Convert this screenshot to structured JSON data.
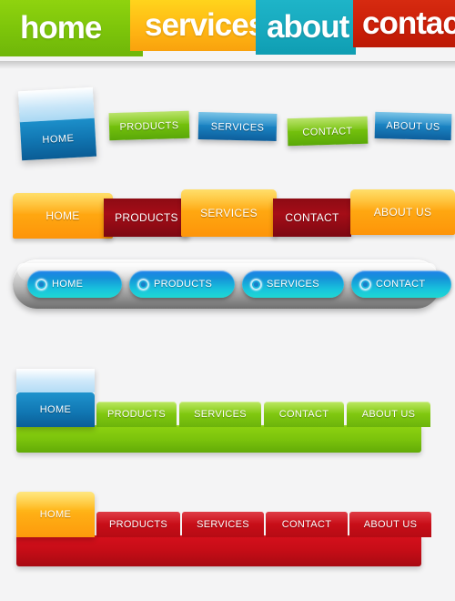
{
  "banner": {
    "blocks": [
      {
        "label": "home",
        "color": "#7cc40a"
      },
      {
        "label": "services",
        "color": "#ffb513"
      },
      {
        "label": "about",
        "color": "#16a8bd"
      },
      {
        "label": "contact",
        "color": "#cb1f08"
      }
    ]
  },
  "glossy_buttons": {
    "home_label": "HOME",
    "items": [
      {
        "label": "PRODUCTS",
        "color": "#73c00c"
      },
      {
        "label": "SERVICES",
        "color": "#1b85c4"
      },
      {
        "label": "CONTACT",
        "color": "#73c00c"
      },
      {
        "label": "ABOUT US",
        "color": "#1b85c4"
      }
    ]
  },
  "orange_red_bar": {
    "items": [
      {
        "label": "HOME",
        "color": "#ffa811"
      },
      {
        "label": "PRODUCTS",
        "color": "#a50d17"
      },
      {
        "label": "SERVICES",
        "color": "#ffa811"
      },
      {
        "label": "CONTACT",
        "color": "#a50d17"
      },
      {
        "label": "ABOUT US",
        "color": "#ffa811"
      }
    ]
  },
  "silver_bar": {
    "items": [
      {
        "label": "HOME",
        "icon": "globe-icon"
      },
      {
        "label": "PRODUCTS",
        "icon": "globe-icon"
      },
      {
        "label": "SERVICES",
        "icon": "globe-icon"
      },
      {
        "label": "CONTACT",
        "icon": "globe-icon"
      }
    ],
    "pill_color": "#18c4dd",
    "bar_color": "#b9b9b9"
  },
  "green_bar": {
    "home_label": "HOME",
    "home_color": "#1178b4",
    "bar_color": "#7cc40c",
    "items": [
      {
        "label": "PRODUCTS"
      },
      {
        "label": "SERVICES"
      },
      {
        "label": "CONTACT"
      },
      {
        "label": "ABOUT US"
      }
    ]
  },
  "red_bar": {
    "home_label": "HOME",
    "home_color": "#ffae14",
    "bar_color": "#c70d17",
    "items": [
      {
        "label": "PRODUCTS"
      },
      {
        "label": "SERVICES"
      },
      {
        "label": "CONTACT"
      },
      {
        "label": "ABOUT US"
      }
    ]
  }
}
